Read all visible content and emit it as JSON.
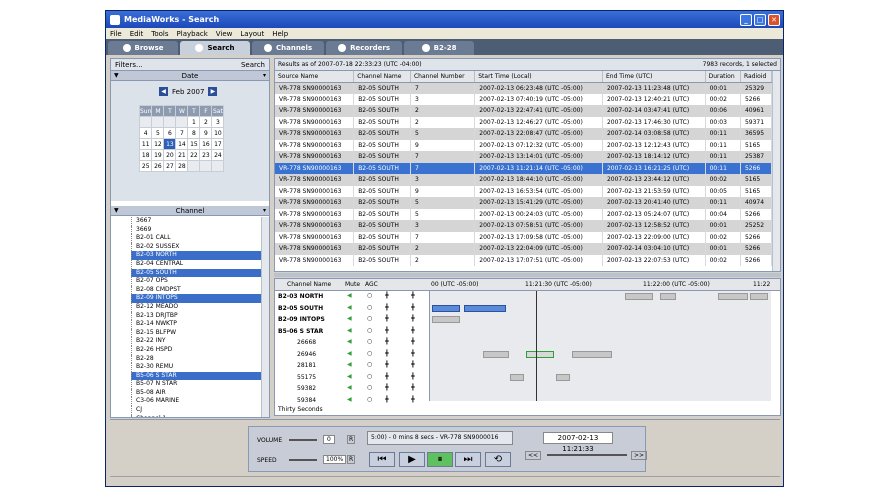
{
  "window": {
    "title": "MediaWorks - Search"
  },
  "menu": [
    "File",
    "Edit",
    "Tools",
    "Playback",
    "View",
    "Layout",
    "Help"
  ],
  "tabs": [
    {
      "label": "Browse"
    },
    {
      "label": "Search"
    },
    {
      "label": "Channels"
    },
    {
      "label": "Recorders"
    },
    {
      "label": "B2-28"
    }
  ],
  "left": {
    "filters_label": "Filters...",
    "search_label": "Search",
    "date_header": "Date",
    "month": "Feb 2007",
    "weekdays": [
      "Sun",
      "M",
      "T",
      "W",
      "T",
      "F",
      "Sat"
    ],
    "weeks": [
      [
        "",
        "",
        "",
        "",
        "1",
        "2",
        "3"
      ],
      [
        "4",
        "5",
        "6",
        "7",
        "8",
        "9",
        "10"
      ],
      [
        "11",
        "12",
        "13",
        "14",
        "15",
        "16",
        "17"
      ],
      [
        "18",
        "19",
        "20",
        "21",
        "22",
        "23",
        "24"
      ],
      [
        "25",
        "26",
        "27",
        "28",
        "",
        "",
        ""
      ]
    ],
    "selected_day": "13",
    "channel_header": "Channel",
    "channels": [
      "3667",
      "3669",
      "B2-01 CALL",
      "B2-02 SUSSEX",
      "B2-03 NORTH",
      "B2-04 CENTRAL",
      "B2-05 SOUTH",
      "B2-07 OPS",
      "B2-08 CMDPST",
      "B2-09 INTOPS",
      "B2-12 MEADO",
      "B2-13 DRJTBP",
      "B2-14 NWKTP",
      "B2-15 BLFPW",
      "B2-22 INY",
      "B2-26 HSPD",
      "B2-28",
      "B2-30 REMU",
      "B5-06 S STAR",
      "B5-07 N STAR",
      "B5-08 AIR",
      "C3-06 MARINE",
      "CJ",
      "Channel 1",
      "Channel 2"
    ],
    "selected_channels": [
      "B2-03 NORTH",
      "B2-05 SOUTH",
      "B2-09 INTOPS",
      "B5-06 S STAR"
    ]
  },
  "results": {
    "header_left": "Results as of 2007-07-18 22:33:23 (UTC -04:00)",
    "header_right": "7983 records, 1 selected",
    "columns": [
      "Source Name",
      "Channel Name",
      "Channel Number",
      "Start Time (Local)",
      "End Time (UTC)",
      "Duration",
      "Radioid"
    ],
    "rows": [
      [
        "VR-778 SN90000163",
        "B2-05 SOUTH",
        "7",
        "2007-02-13 06:23:48 (UTC -05:00)",
        "2007-02-13 11:23:48 (UTC)",
        "00:01",
        "25329"
      ],
      [
        "VR-778 SN90000163",
        "B2-05 SOUTH",
        "3",
        "2007-02-13 07:40:19 (UTC -05:00)",
        "2007-02-13 12:40:21 (UTC)",
        "00:02",
        "5266"
      ],
      [
        "VR-778 SN90000163",
        "B2-05 SOUTH",
        "2",
        "2007-02-13 22:47:41 (UTC -05:00)",
        "2007-02-14 03:47:41 (UTC)",
        "00:06",
        "40961"
      ],
      [
        "VR-778 SN90000163",
        "B2-05 SOUTH",
        "2",
        "2007-02-13 12:46:27 (UTC -05:00)",
        "2007-02-13 17:46:30 (UTC)",
        "00:03",
        "59371"
      ],
      [
        "VR-778 SN90000163",
        "B2-05 SOUTH",
        "5",
        "2007-02-13 22:08:47 (UTC -05:00)",
        "2007-02-14 03:08:58 (UTC)",
        "00:11",
        "36595"
      ],
      [
        "VR-778 SN90000163",
        "B2-05 SOUTH",
        "9",
        "2007-02-13 07:12:32 (UTC -05:00)",
        "2007-02-13 12:12:43 (UTC)",
        "00:11",
        "5165"
      ],
      [
        "VR-778 SN90000163",
        "B2-05 SOUTH",
        "7",
        "2007-02-13 13:14:01 (UTC -05:00)",
        "2007-02-13 18:14:12 (UTC)",
        "00:11",
        "25387"
      ],
      [
        "VR-778 SN90000163",
        "B2-05 SOUTH",
        "7",
        "2007-02-13 11:21:14 (UTC -05:00)",
        "2007-02-13 16:21:25 (UTC)",
        "00:11",
        "5266"
      ],
      [
        "VR-778 SN90000163",
        "B2-05 SOUTH",
        "3",
        "2007-02-13 18:44:10 (UTC -05:00)",
        "2007-02-13 23:44:12 (UTC)",
        "00:02",
        "5165"
      ],
      [
        "VR-778 SN90000163",
        "B2-05 SOUTH",
        "9",
        "2007-02-13 16:53:54 (UTC -05:00)",
        "2007-02-13 21:53:59 (UTC)",
        "00:05",
        "5165"
      ],
      [
        "VR-778 SN90000163",
        "B2-05 SOUTH",
        "5",
        "2007-02-13 15:41:29 (UTC -05:00)",
        "2007-02-13 20:41:40 (UTC)",
        "00:11",
        "40974"
      ],
      [
        "VR-778 SN90000163",
        "B2-05 SOUTH",
        "5",
        "2007-02-13 00:24:03 (UTC -05:00)",
        "2007-02-13 05:24:07 (UTC)",
        "00:04",
        "5266"
      ],
      [
        "VR-778 SN90000163",
        "B2-05 SOUTH",
        "3",
        "2007-02-13 07:58:51 (UTC -05:00)",
        "2007-02-13 12:58:52 (UTC)",
        "00:01",
        "25252"
      ],
      [
        "VR-778 SN90000163",
        "B2-05 SOUTH",
        "7",
        "2007-02-13 17:09:58 (UTC -05:00)",
        "2007-02-13 22:09:00 (UTC)",
        "00:02",
        "5266"
      ],
      [
        "VR-778 SN90000163",
        "B2-05 SOUTH",
        "2",
        "2007-02-13 22:04:09 (UTC -05:00)",
        "2007-02-14 03:04:10 (UTC)",
        "00:01",
        "5266"
      ],
      [
        "VR-778 SN90000163",
        "B2-05 SOUTH",
        "2",
        "2007-02-13 17:07:51 (UTC -05:00)",
        "2007-02-13 22:07:53 (UTC)",
        "00:02",
        "5266"
      ]
    ],
    "selected_index": 7
  },
  "timeline": {
    "col_channel": "Channel Name",
    "col_mute": "Mute",
    "col_agc": "AGC",
    "ticks": [
      "00 (UTC -05:00)",
      "11:21:30 (UTC -05:00)",
      "11:22:00 (UTC -05:00)",
      "11:22"
    ],
    "rows": [
      {
        "name": "B2-03 NORTH",
        "group": true
      },
      {
        "name": "B2-05 SOUTH",
        "group": true
      },
      {
        "name": "B2-09 INTOPS",
        "group": true
      },
      {
        "name": "B5-06 S STAR",
        "group": true,
        "expanded": true
      },
      {
        "name": "26668",
        "group": false
      },
      {
        "name": "26946",
        "group": false
      },
      {
        "name": "28181",
        "group": false
      },
      {
        "name": "55175",
        "group": false
      },
      {
        "name": "59382",
        "group": false
      },
      {
        "name": "59384",
        "group": false
      }
    ],
    "footer_label": "Thirty Seconds"
  },
  "player": {
    "volume_label": "VOLUME",
    "volume_value": "0",
    "speed_label": "SPEED",
    "speed_value": "100%",
    "r_label": "R",
    "status_text": "5:00)  - 0 mins 8 secs  - VR-778 SN9000016",
    "datetime": "2007-02-13 11:21:33",
    "rewind_label": "<<",
    "forward_label": ">>"
  }
}
